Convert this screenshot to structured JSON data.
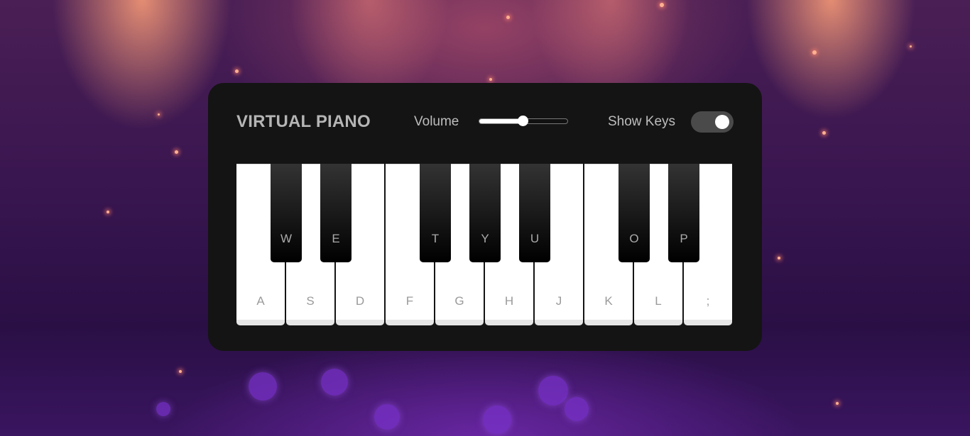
{
  "app": {
    "title": "VIRTUAL PIANO"
  },
  "volume": {
    "label": "Volume",
    "level": 0.5
  },
  "show_keys": {
    "label": "Show Keys",
    "enabled": true
  },
  "white_keys": [
    "A",
    "S",
    "D",
    "F",
    "G",
    "H",
    "J",
    "K",
    "L",
    ";"
  ],
  "black_keys": [
    "W",
    "E",
    "T",
    "Y",
    "U",
    "O",
    "P"
  ],
  "colors": {
    "panel": "#141414",
    "accent": "#ffffff"
  }
}
